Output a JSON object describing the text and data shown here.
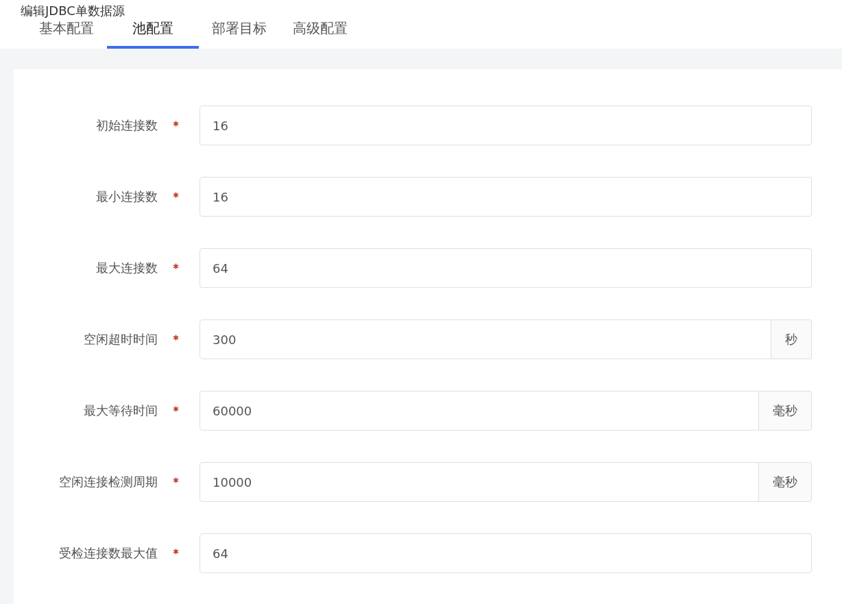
{
  "title": "编辑JDBC单数据源",
  "tabs": [
    {
      "label": "基本配置",
      "selected": false
    },
    {
      "label": "池配置",
      "selected": true
    },
    {
      "label": "部署目标",
      "selected": false
    },
    {
      "label": "高级配置",
      "selected": false
    }
  ],
  "fields": [
    {
      "label": "初始连接数",
      "required": true,
      "value": "16"
    },
    {
      "label": "最小连接数",
      "required": true,
      "value": "16"
    },
    {
      "label": "最大连接数",
      "required": true,
      "value": "64"
    },
    {
      "label": "空闲超时时间",
      "required": true,
      "value": "300",
      "unit": "秒"
    },
    {
      "label": "最大等待时间",
      "required": true,
      "value": "60000",
      "unit": "毫秒"
    },
    {
      "label": "空闲连接检测周期",
      "required": true,
      "value": "10000",
      "unit": "毫秒"
    },
    {
      "label": "受检连接数最大值",
      "required": true,
      "value": "64"
    }
  ]
}
